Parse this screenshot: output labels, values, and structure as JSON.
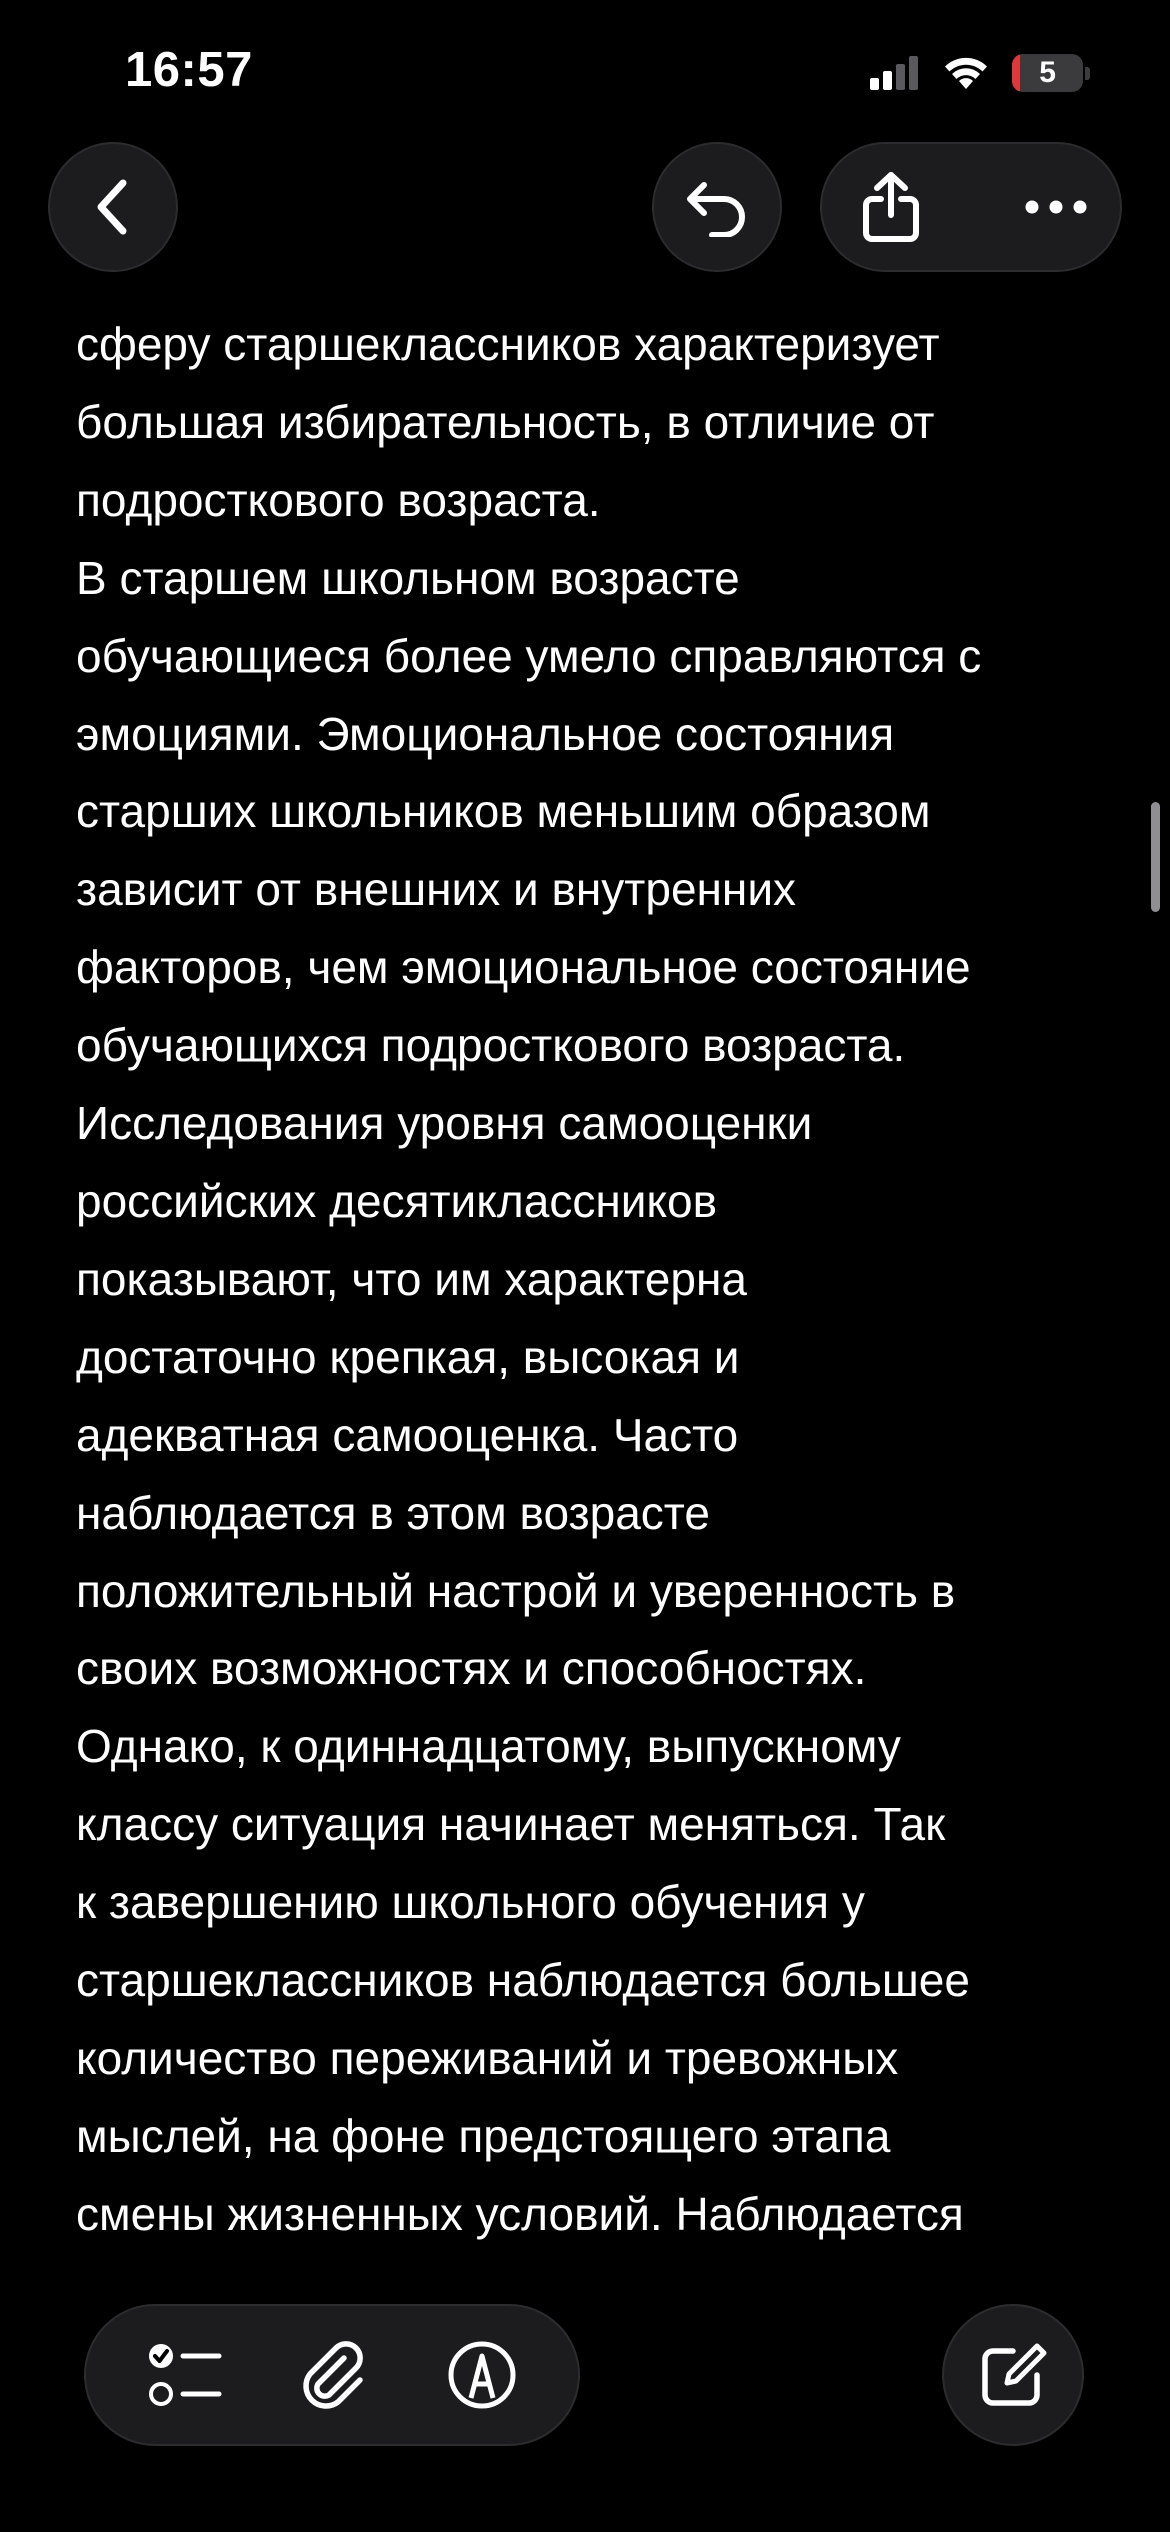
{
  "status_bar": {
    "time": "16:57",
    "battery_level": "5",
    "battery_fraction": 0.05,
    "icons": [
      "cellular-signal-icon",
      "wifi-icon",
      "battery-icon"
    ]
  },
  "nav": {
    "icons": [
      "chevron-left-icon",
      "undo-icon",
      "share-icon",
      "ellipsis-icon"
    ]
  },
  "note": {
    "text": "сферу старшеклассников характеризует\nбольшая избирательность, в отличие от\nподросткового возраста.\nВ старшем школьном возрасте\nобучающиеся более умело справляются с\nэмоциями. Эмоциональное состояния\nстарших школьников меньшим образом\nзависит от внешних и внутренних\nфакторов, чем эмоциональное состояние\nобучающихся подросткового возраста.\nИсследования уровня самооценки\nроссийских десятиклассников\nпоказывают, что им характерна\nдостаточно крепкая, высокая и\nадекватная самооценка. Часто\nнаблюдается в этом возрасте\nположительный настрой и уверенность в\nсвоих возможностях и способностях.\nОднако, к одиннадцатому, выпускному\nклассу ситуация начинает меняться. Так\nк завершению школьного обучения у\nстаршеклассников наблюдается большее\nколичество переживаний и тревожных\nмыслей, на фоне предстоящего этапа\nсмены жизненных условий. Наблюдается"
  },
  "toolbar": {
    "icons": [
      "checklist-icon",
      "paperclip-icon",
      "markup-pen-icon",
      "compose-icon"
    ]
  },
  "colors": {
    "background": "#000000",
    "text": "#ffffff",
    "button_bg": "#1c1c1e",
    "battery_low": "#e0373a"
  }
}
